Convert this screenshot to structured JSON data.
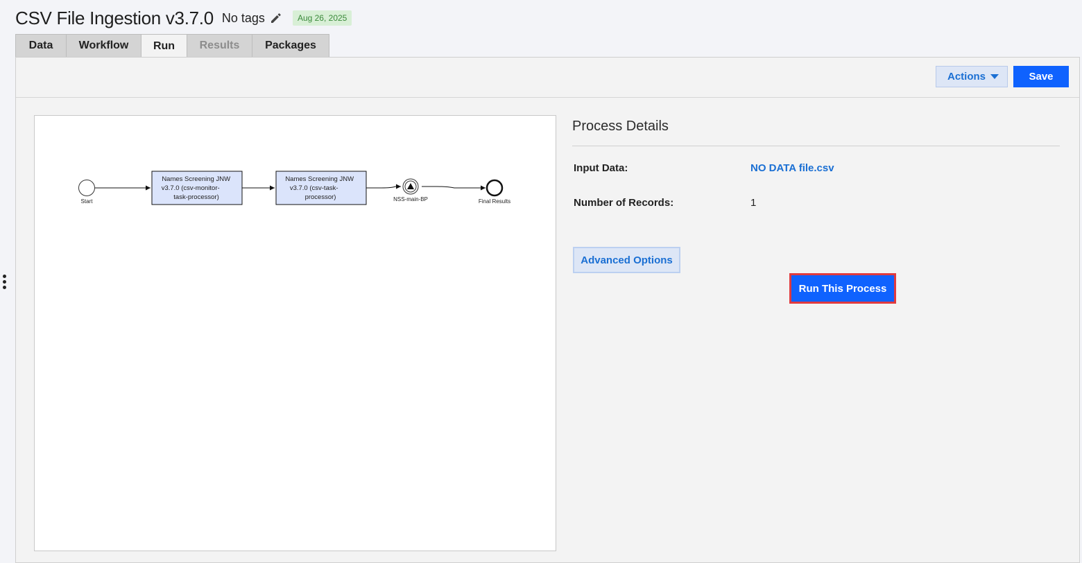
{
  "header": {
    "title": "CSV File Ingestion v3.7.0",
    "tags_label": "No tags",
    "date_badge": "Aug 26, 2025"
  },
  "tabs": [
    {
      "label": "Data",
      "state": "normal"
    },
    {
      "label": "Workflow",
      "state": "normal"
    },
    {
      "label": "Run",
      "state": "active"
    },
    {
      "label": "Results",
      "state": "disabled"
    },
    {
      "label": "Packages",
      "state": "normal"
    }
  ],
  "toolbar": {
    "actions_label": "Actions",
    "save_label": "Save"
  },
  "diagram": {
    "start_label": "Start",
    "task1_lines": [
      "Names Screening JNW",
      "v3.7.0 (csv-monitor-",
      "task-processor)"
    ],
    "task2_lines": [
      "Names Screening JNW",
      "v3.7.0 (csv-task-",
      "processor)"
    ],
    "event_label": "NSS-main-BP",
    "end_label": "Final Results"
  },
  "details": {
    "title": "Process Details",
    "input_label": "Input Data:",
    "input_value": "NO DATA file.csv",
    "records_label": "Number of Records:",
    "records_value": "1",
    "advanced_label": "Advanced Options",
    "run_label": "Run This Process"
  },
  "colors": {
    "primary": "#0f62fe",
    "link": "#1a6fd3",
    "highlight_border": "#e03a3e",
    "task_fill": "#dbe4fb",
    "badge_bg": "#d8efd6"
  }
}
